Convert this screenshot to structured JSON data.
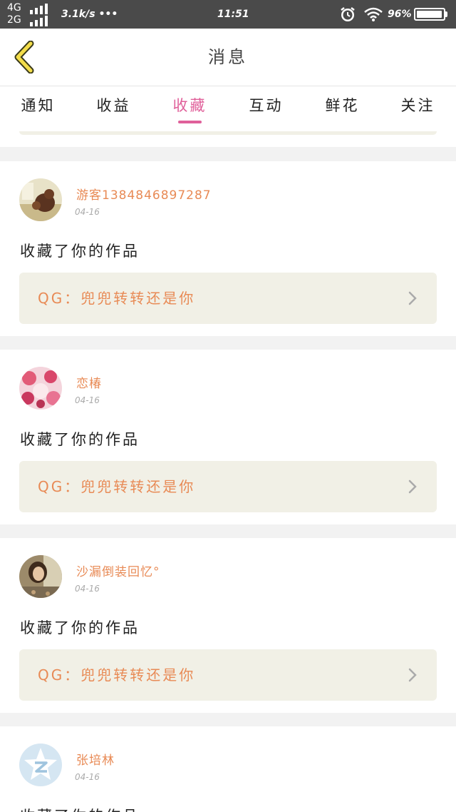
{
  "status_bar": {
    "network_top": "4G",
    "network_bottom": "2G",
    "speed": "3.1k/s",
    "dots": "•••",
    "time": "11:51",
    "battery_text": "96%",
    "battery_level": 0.96
  },
  "header": {
    "title": "消息"
  },
  "tabs": [
    {
      "label": "通知",
      "active": false
    },
    {
      "label": "收益",
      "active": false
    },
    {
      "label": "收藏",
      "active": true
    },
    {
      "label": "互动",
      "active": false
    },
    {
      "label": "鲜花",
      "active": false
    },
    {
      "label": "关注",
      "active": false
    }
  ],
  "colors": {
    "accent_pink": "#e0609a",
    "username_orange": "#e88a55",
    "card_box_bg": "#f1f0e6"
  },
  "notifications": [
    {
      "username": "游客1384846897287",
      "date": "04-16",
      "action": "收藏了你的作品",
      "work": "QG：兜兜转转还是你",
      "avatar_icon": "bear-photo-avatar"
    },
    {
      "username": "恋椿",
      "date": "04-16",
      "action": "收藏了你的作品",
      "work": "QG：兜兜转转还是你",
      "avatar_icon": "anime-girl-avatar"
    },
    {
      "username": "沙漏倒装回忆°",
      "date": "04-16",
      "action": "收藏了你的作品",
      "work": "QG：兜兜转转还是你",
      "avatar_icon": "girl-photo-avatar"
    },
    {
      "username": "张培林",
      "date": "04-16",
      "action": "收藏了你的作品",
      "work": "",
      "avatar_icon": "qzone-star-avatar"
    }
  ]
}
